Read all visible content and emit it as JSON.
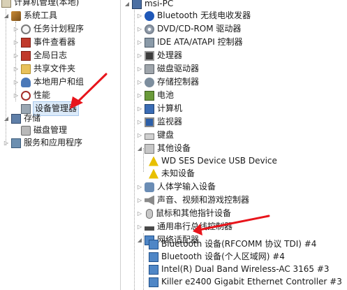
{
  "left_tree": {
    "root": "计算机管理(本地)",
    "system_tools": "系统工具",
    "task_scheduler": "任务计划程序",
    "event_viewer": "事件查看器",
    "event_log": "全局日志",
    "shared_folders": "共享文件夹",
    "local_users": "本地用户和组",
    "performance": "性能",
    "device_manager": "设备管理器",
    "storage": "存储",
    "disk_management": "磁盘管理",
    "services": "服务和应用程序"
  },
  "right_tree": {
    "computer": "msi-PC",
    "categories": [
      "Bluetooth 无线电收发器",
      "DVD/CD-ROM 驱动器",
      "IDE ATA/ATAPI 控制器",
      "处理器",
      "磁盘驱动器",
      "存储控制器",
      "电池",
      "计算机",
      "监视器",
      "键盘",
      "其他设备"
    ],
    "other_devices": [
      "WD SES Device USB Device",
      "未知设备"
    ],
    "categories2": [
      "人体学输入设备",
      "声音、视频和游戏控制器",
      "鼠标和其他指针设备",
      "通用串行总线控制器",
      "网络适配器"
    ],
    "network_adapters": [
      "Bluetooth 设备(RFCOMM 协议 TDI) #4",
      "Bluetooth 设备(个人区域网) #4",
      "Intel(R) Dual Band Wireless-AC 3165 #3",
      "Killer e2400 Gigabit Ethernet Controller #3"
    ]
  },
  "colors": {
    "annotation_arrow": "#e8141b",
    "selection": "#dbeaf9"
  }
}
